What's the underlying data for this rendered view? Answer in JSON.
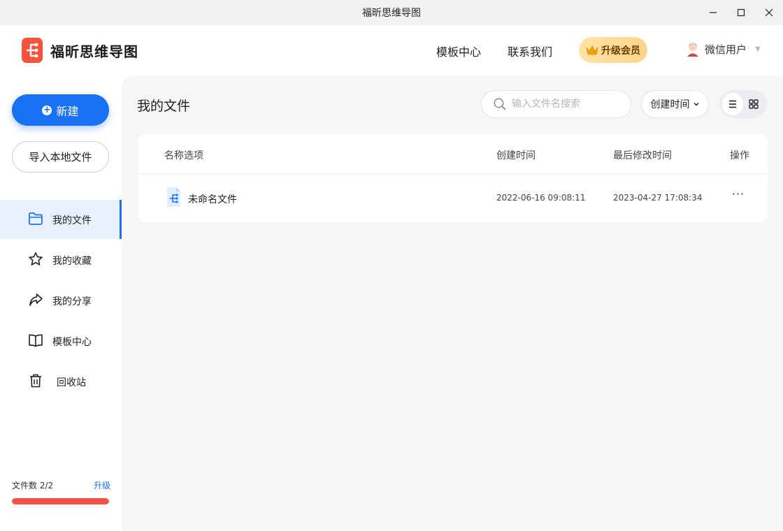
{
  "window": {
    "title": "福昕思维导图"
  },
  "header": {
    "app_name": "福昕思维导图",
    "nav": {
      "templates": "模板中心",
      "contact": "联系我们"
    },
    "vip_button": "升级会员",
    "user_name": "微信用户"
  },
  "sidebar": {
    "new_button": "新建",
    "import_button": "导入本地文件",
    "items": [
      {
        "label": "我的文件",
        "icon": "folder-icon",
        "active": true
      },
      {
        "label": "我的收藏",
        "icon": "star-icon",
        "active": false
      },
      {
        "label": "我的分享",
        "icon": "share-icon",
        "active": false
      },
      {
        "label": "模板中心",
        "icon": "book-icon",
        "active": false
      },
      {
        "label": "回收站",
        "icon": "trash-icon",
        "active": false
      }
    ],
    "file_count": "文件数 2/2",
    "upgrade": "升级",
    "quota_fraction": 1.0
  },
  "main": {
    "title": "我的文件",
    "search_placeholder": "输入文件名搜索",
    "sort_label": "创建时间",
    "view_mode": "list",
    "table": {
      "headers": {
        "name": "名称选项",
        "created": "创建时间",
        "modified": "最后修改时间",
        "actions": "操作"
      },
      "rows": [
        {
          "name": "未命名文件",
          "created": "2022-06-16 09:08:11",
          "modified": "2023-04-27 17:08:34",
          "more": "···"
        }
      ]
    }
  },
  "colors": {
    "accent": "#1971f5",
    "logo": "#f5533d",
    "quota": "#f5534a",
    "vip_gradient": "#fdd58a"
  }
}
